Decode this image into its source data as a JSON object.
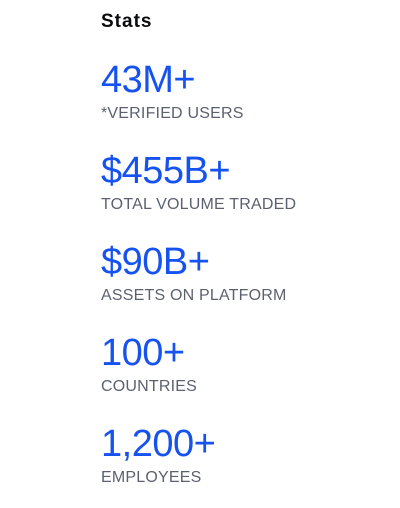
{
  "section": {
    "title": "Stats"
  },
  "stats": [
    {
      "value": "43M+",
      "label": "*VERIFIED USERS"
    },
    {
      "value": "$455B+",
      "label": "TOTAL VOLUME TRADED"
    },
    {
      "value": "$90B+",
      "label": "ASSETS ON PLATFORM"
    },
    {
      "value": "100+",
      "label": "COUNTRIES"
    },
    {
      "value": "1,200+",
      "label": "EMPLOYEES"
    }
  ],
  "colors": {
    "accent": "#1652f0",
    "label": "#5b616e",
    "title": "#0a0b0d",
    "background": "#ffffff"
  }
}
